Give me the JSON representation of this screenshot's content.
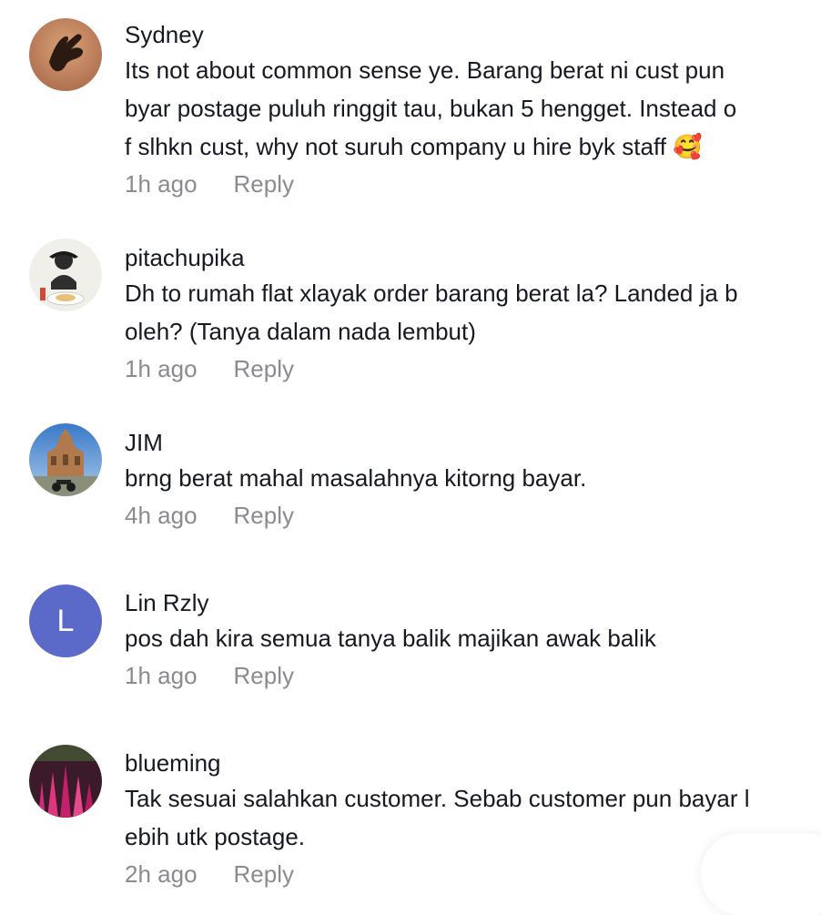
{
  "comments": [
    {
      "username": "Sydney",
      "text": "Its not about common sense ye. Barang berat ni cust pun\nbyar postage puluh ringgit tau, bukan 5 hengget. Instead o\nf slhkn cust, why not suruh company u hire byk staff 🥰",
      "time": "1h ago",
      "reply": "Reply",
      "avatar": "hand-silhouette-avatar"
    },
    {
      "username": "pitachupika",
      "text": "Dh to rumah flat xlayak order barang berat la? Landed ja b\noleh? (Tanya dalam nada lembut)",
      "time": "1h ago",
      "reply": "Reply",
      "avatar": "person-dining-avatar"
    },
    {
      "username": "JIM",
      "text": "brng berat mahal masalahnya kitorng bayar.",
      "time": "4h ago",
      "reply": "Reply",
      "avatar": "building-motorcycle-avatar"
    },
    {
      "username": "Lin Rzly",
      "text": "pos dah kira semua tanya balik majikan awak balik",
      "time": "1h ago",
      "reply": "Reply",
      "avatar": "letter-avatar",
      "avatar_letter": "L",
      "avatar_color": "#5b6ac9"
    },
    {
      "username": "blueming",
      "text": "Tak sesuai salahkan customer. Sebab customer pun bayar l\nebih utk postage.",
      "time": "2h ago",
      "reply": "Reply",
      "avatar": "pink-flowers-avatar"
    }
  ],
  "colors": {
    "text": "#161823",
    "muted": "#8a8b91"
  }
}
